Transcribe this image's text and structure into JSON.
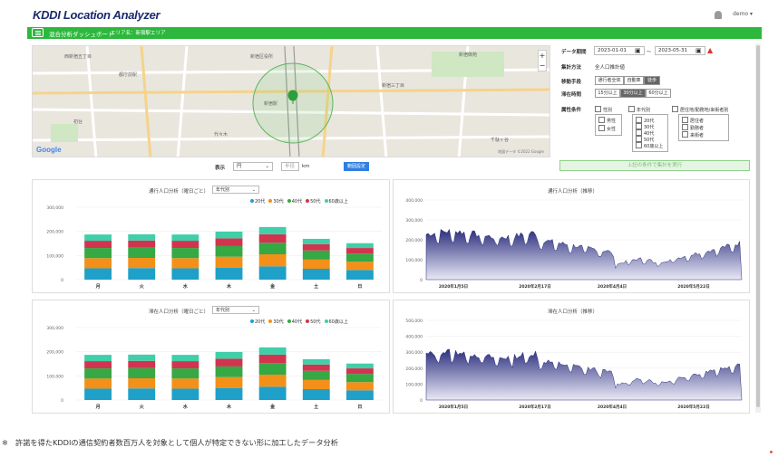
{
  "header": {
    "logo_kddi": "KDDI",
    "logo_rest": " Location Analyzer",
    "user": "demo ▾"
  },
  "greenbar": {
    "title": "混合分析ダッシュボード",
    "area_label": "エリア名：新宿駅エリア"
  },
  "map": {
    "labels": [
      {
        "text": "西新宿五丁目",
        "x": 35,
        "y": 8
      },
      {
        "text": "新宿区役所",
        "x": 240,
        "y": 8
      },
      {
        "text": "新宿御苑",
        "x": 470,
        "y": 6
      },
      {
        "text": "都庁前駅",
        "x": 95,
        "y": 28
      },
      {
        "text": "新宿駅",
        "x": 255,
        "y": 60
      },
      {
        "text": "代々木",
        "x": 200,
        "y": 94
      },
      {
        "text": "新宿三丁目",
        "x": 385,
        "y": 40
      },
      {
        "text": "初台",
        "x": 45,
        "y": 80
      },
      {
        "text": "千駄ヶ谷",
        "x": 505,
        "y": 100
      }
    ],
    "copyright": "地図データ ©2022 Google"
  },
  "controls": {
    "period_label": "データ期間",
    "date_from": "2023-01-01",
    "date_to": "2023-05-31",
    "tilde": "〜",
    "method_label": "集計方法",
    "method_value": "全人口推計値",
    "transport_label": "移動手段",
    "transport_options": [
      "通行者全体",
      "自動車",
      "徒歩"
    ],
    "stay_label": "滞在時間",
    "stay_options": [
      "15分以上",
      "30分以上",
      "60分以上"
    ],
    "attr_label": "属性条件",
    "gender_label": "性別",
    "gender_options": [
      "男性",
      "女性"
    ],
    "age_label": "年代別",
    "age_options": [
      "20代",
      "30代",
      "40代",
      "50代",
      "60歳以上"
    ],
    "residence_label": "居住地/勤務地/来街者別",
    "residence_options": [
      "居住者",
      "勤務者",
      "来街者"
    ],
    "exec_label": "上記の条件で集計を実行",
    "display_label": "表示",
    "display_value": "円",
    "radius_label": "半径",
    "radius_unit": "km",
    "apply_button": "範囲設定"
  },
  "panels": {
    "p1_title": "通行人口分析（曜日ごと）",
    "p2_title": "通行人口分析（推移）",
    "p3_title": "滞在人口分析（曜日ごと）",
    "p4_title": "滞在人口分析（推移）",
    "select_value": "年代別"
  },
  "colors": {
    "teal": "#1ea0c8",
    "orange": "#f39019",
    "green": "#36a844",
    "red": "#d2344f",
    "mint": "#40cfa8",
    "navy": "#2c2f7e"
  },
  "chart_data": [
    {
      "type": "bar",
      "stacked": true,
      "title": "通行人口分析（曜日ごと）",
      "categories": [
        "月",
        "火",
        "水",
        "木",
        "金",
        "土",
        "日"
      ],
      "series": [
        {
          "name": "20代",
          "values": [
            47000,
            48000,
            47000,
            50000,
            55000,
            45000,
            40000
          ]
        },
        {
          "name": "30代",
          "values": [
            42000,
            42000,
            42000,
            45000,
            50000,
            38000,
            34000
          ]
        },
        {
          "name": "40代",
          "values": [
            42000,
            42000,
            42000,
            44000,
            48000,
            38000,
            34000
          ]
        },
        {
          "name": "50代",
          "values": [
            30000,
            30000,
            30000,
            32000,
            35000,
            26000,
            23000
          ]
        },
        {
          "name": "60歳以上",
          "values": [
            26000,
            26000,
            26000,
            28000,
            30000,
            22000,
            20000
          ]
        }
      ],
      "yticks": [
        "0",
        "100,000",
        "200,000",
        "300,000"
      ],
      "ylim": [
        0,
        300000
      ]
    },
    {
      "type": "area",
      "title": "通行人口分析（推移）",
      "xticks": [
        "2020年1月5日",
        "2020年2月17日",
        "2020年4月4日",
        "2020年5月22日"
      ],
      "yticks": [
        "0",
        "100,000",
        "200,000",
        "300,000",
        "400,000"
      ],
      "ylim": [
        0,
        400000
      ]
    },
    {
      "type": "bar",
      "stacked": true,
      "title": "滞在人口分析（曜日ごと）",
      "categories": [
        "月",
        "火",
        "水",
        "木",
        "金",
        "土",
        "日"
      ],
      "series": [
        {
          "name": "20代",
          "values": [
            47000,
            48000,
            47000,
            50000,
            55000,
            45000,
            40000
          ]
        },
        {
          "name": "30代",
          "values": [
            42000,
            42000,
            42000,
            45000,
            50000,
            38000,
            34000
          ]
        },
        {
          "name": "40代",
          "values": [
            42000,
            42000,
            42000,
            44000,
            48000,
            38000,
            34000
          ]
        },
        {
          "name": "50代",
          "values": [
            30000,
            30000,
            30000,
            32000,
            35000,
            26000,
            23000
          ]
        },
        {
          "name": "60歳以上",
          "values": [
            26000,
            26000,
            26000,
            28000,
            30000,
            22000,
            20000
          ]
        }
      ],
      "yticks": [
        "0",
        "100,000",
        "200,000",
        "300,000"
      ],
      "ylim": [
        0,
        300000
      ]
    },
    {
      "type": "area",
      "title": "滞在人口分析（推移）",
      "xticks": [
        "2020年1月5日",
        "2020年2月17日",
        "2020年4月4日",
        "2020年5月22日"
      ],
      "yticks": [
        "0",
        "100,000",
        "200,000",
        "300,000",
        "400,000",
        "500,000"
      ],
      "ylim": [
        0,
        500000
      ]
    }
  ],
  "footnote": "※　許諾を得たKDDIの通信契約者数百万人を対象として個人が特定できない形に加工したデータ分析"
}
